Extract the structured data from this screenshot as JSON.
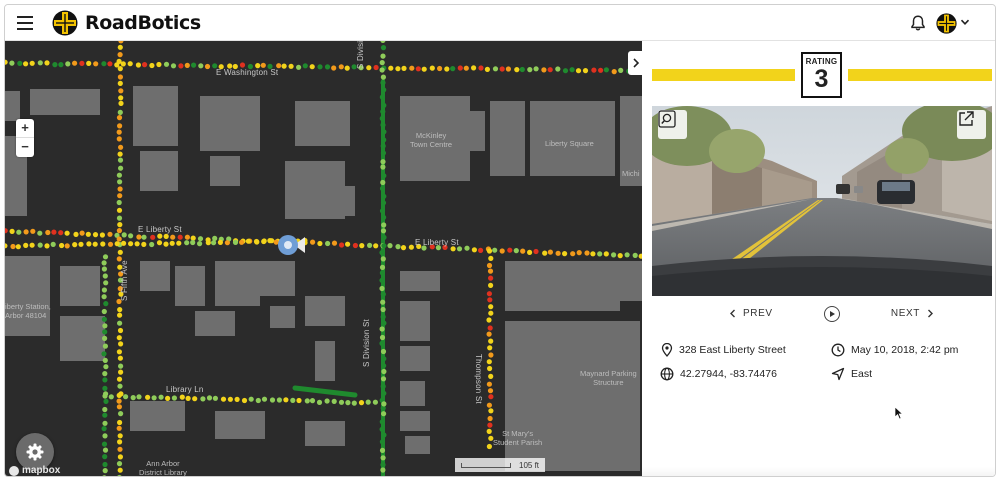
{
  "app": {
    "name": "RoadBotics"
  },
  "header": {
    "menu_icon": "hamburger-menu-icon",
    "notifications_icon": "bell-icon",
    "account_icon": "roadbotics-avatar-icon",
    "account_caret_icon": "chevron-down-icon"
  },
  "map": {
    "road_labels": {
      "washington": "E Washington St",
      "liberty_west": "E Liberty St",
      "liberty_east": "E Liberty St",
      "library": "Library Ln",
      "division_north": "S Division St",
      "division_south": "S Division St",
      "fifth": "S Fifth Ave",
      "thompson": "Thompson St"
    },
    "poi_labels": {
      "mckinley": "McKinley\nTown Centre",
      "liberty_square": "Liberty Square",
      "michigan": "Michi",
      "station": "iberty Station,\nArbor 48104",
      "maynard": "Maynard Parking\nStructure",
      "st_marys": "St Mary's\nStudent Parish",
      "library": "Ann Arbor\nDistrict Library"
    },
    "zoom_in": "+",
    "zoom_out": "−",
    "attribution": "mapbox",
    "scale": "105 ft",
    "rating_colors": {
      "good": "#1f8a2e",
      "fair": "#8fcc5a",
      "moderate": "#f2d31b",
      "poor": "#f29a1b",
      "bad": "#e0311f"
    }
  },
  "panel": {
    "rating_label": "RATING",
    "rating_value": "3",
    "rating_color": "#f2d31b",
    "prev_label": "PREV",
    "next_label": "NEXT",
    "address": "328 East Liberty Street",
    "datetime": "May 10, 2018, 2:42 pm",
    "coordinates": "42.27944, -83.74476",
    "direction": "East"
  }
}
